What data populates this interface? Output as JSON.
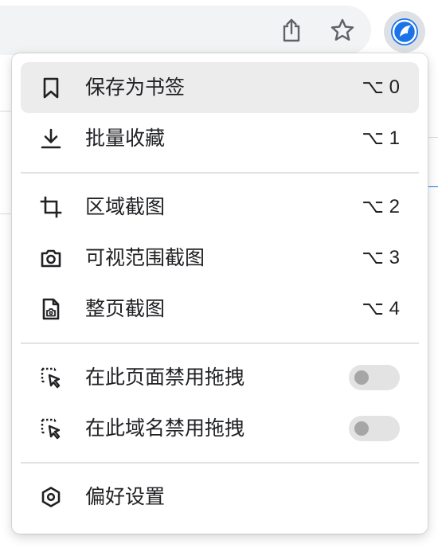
{
  "toolbar": {
    "icons": [
      "share-icon",
      "star-icon",
      "extension-icon"
    ]
  },
  "menu": {
    "items": [
      {
        "label": "保存为书签",
        "shortcut": "⌥ 0",
        "icon": "bookmark-icon",
        "active": true
      },
      {
        "label": "批量收藏",
        "shortcut": "⌥ 1",
        "icon": "download-icon"
      },
      {
        "label": "区域截图",
        "shortcut": "⌥ 2",
        "icon": "crop-icon"
      },
      {
        "label": "可视范围截图",
        "shortcut": "⌥ 3",
        "icon": "camera-icon"
      },
      {
        "label": "整页截图",
        "shortcut": "⌥ 4",
        "icon": "page-camera-icon"
      },
      {
        "label": "在此页面禁用拖拽",
        "toggle": false,
        "icon": "select-cursor-icon"
      },
      {
        "label": "在此域名禁用拖拽",
        "toggle": false,
        "icon": "select-cursor-icon"
      },
      {
        "label": "偏好设置",
        "icon": "settings-hex-icon"
      }
    ]
  },
  "colors": {
    "accent": "#1a73e8",
    "active_row": "#ececec",
    "toggle_track": "#e3e3e3",
    "toggle_knob": "#a6a6a6"
  }
}
